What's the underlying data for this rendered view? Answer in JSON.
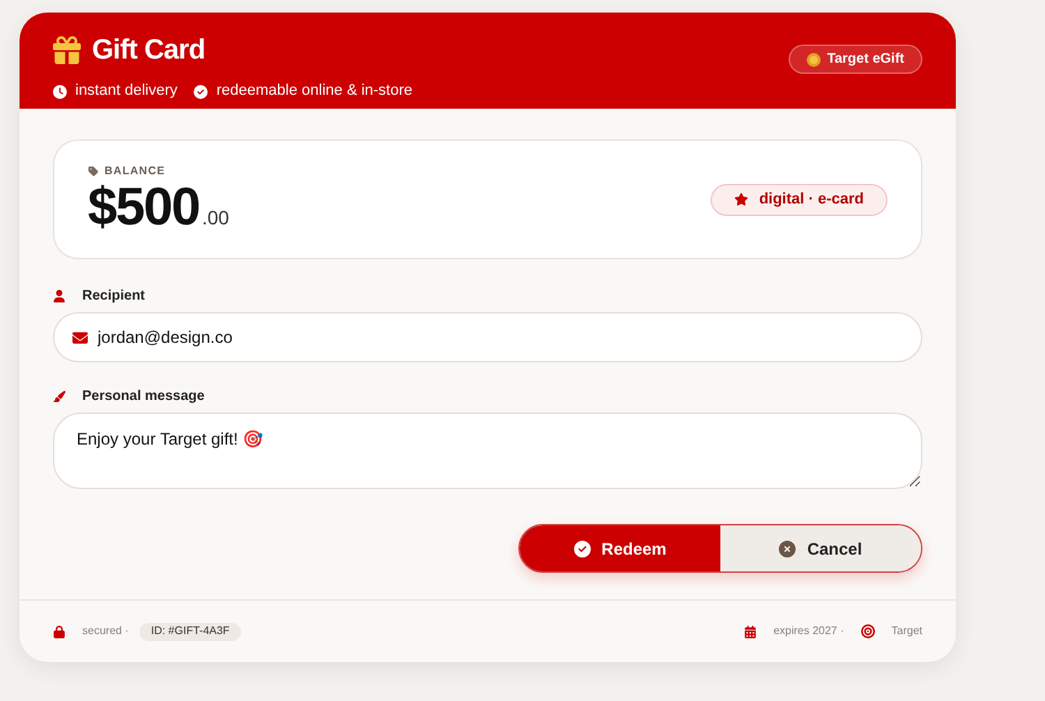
{
  "header": {
    "title": "Gift Card",
    "features": [
      "instant delivery",
      "redeemable online & in-store"
    ],
    "badge": "Target eGift"
  },
  "balance": {
    "label": "BALANCE",
    "amount": "$500",
    "cents": ".00",
    "tag": "digital · e-card"
  },
  "recipient": {
    "label": "Recipient",
    "value": "jordan@design.co"
  },
  "message": {
    "label": "Personal message",
    "value": "Enjoy your Target gift! 🎯"
  },
  "buttons": [
    {
      "label": "Redeem",
      "kind": "primary"
    },
    {
      "label": "Cancel",
      "kind": "secondary"
    }
  ],
  "footer": {
    "secured": "secured ·",
    "id": "ID: #GIFT-4A3F",
    "expires": "expires 2027 ·",
    "brand": "Target"
  }
}
